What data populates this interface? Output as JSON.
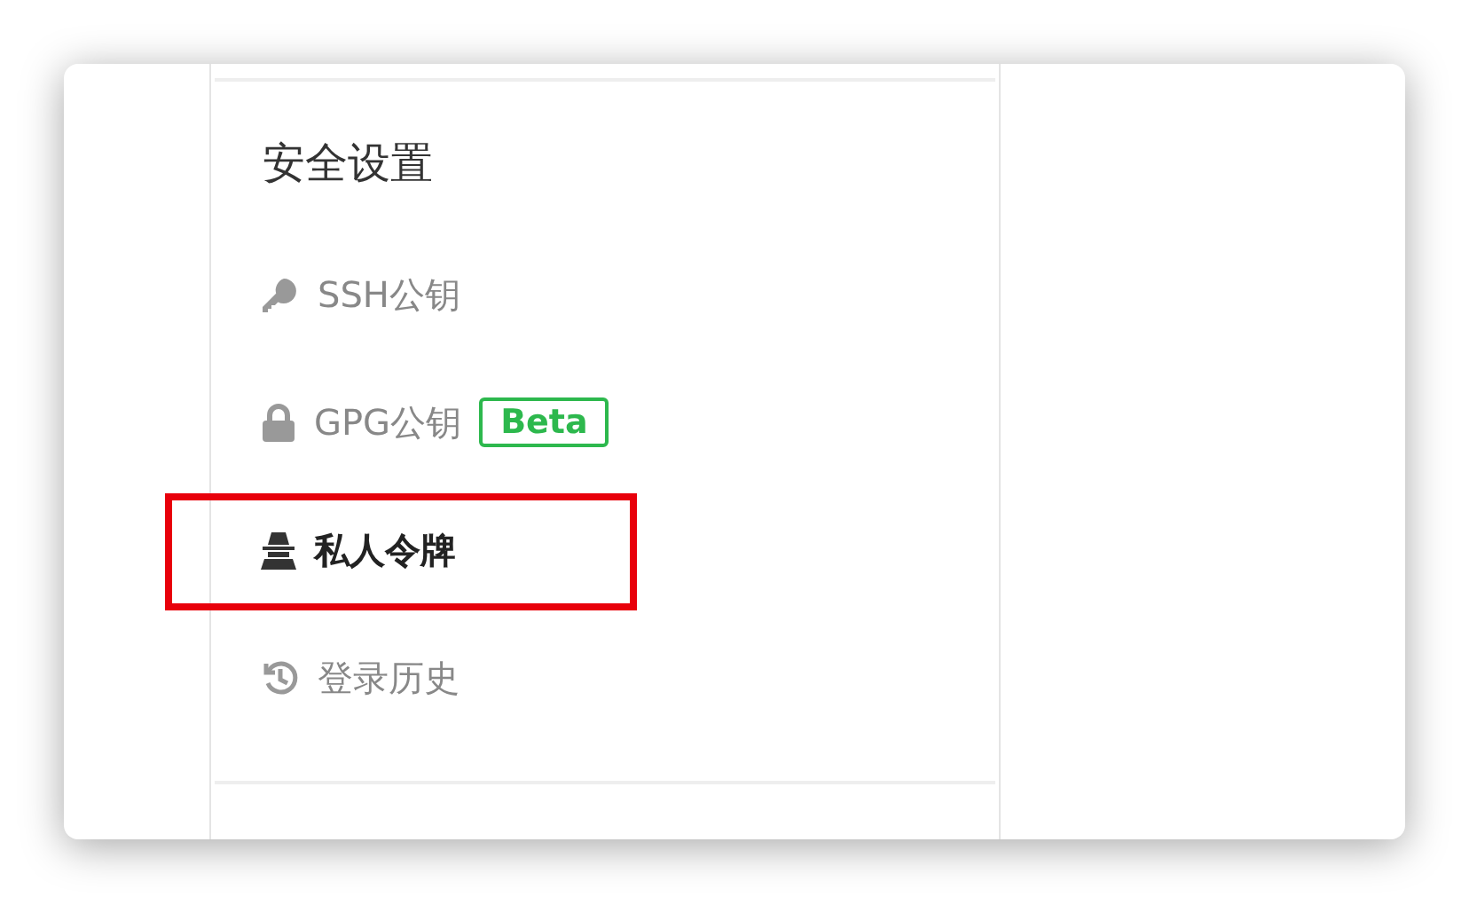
{
  "section": {
    "title": "安全设置"
  },
  "items": [
    {
      "label": "SSH公钥",
      "kind": "key",
      "selected": false,
      "highlighted": false
    },
    {
      "label": "GPG公钥",
      "kind": "lock",
      "selected": false,
      "highlighted": false,
      "badge": "Beta"
    },
    {
      "label": "私人令牌",
      "kind": "agent",
      "selected": true,
      "highlighted": true
    },
    {
      "label": "登录历史",
      "kind": "history",
      "selected": false,
      "highlighted": false
    }
  ]
}
